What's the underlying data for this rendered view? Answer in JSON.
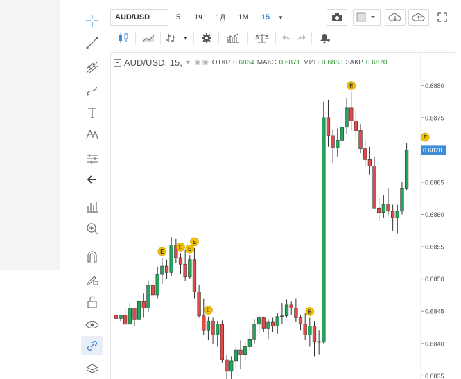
{
  "toolbar": {
    "symbol": "AUD/USD",
    "intervals": [
      "5",
      "1ч",
      "1Д",
      "1М",
      "15"
    ],
    "selected_interval": "15",
    "dropdown_arrow": "▼"
  },
  "legend": {
    "title": "AUD/USD, 15,",
    "open_label": "ОТКР",
    "open_value": "0.6864",
    "high_label": "МАКС",
    "high_value": "0.6871",
    "low_label": "МИН",
    "low_value": "0.6863",
    "close_label": "ЗАКР",
    "close_value": "0.6870"
  },
  "colors": {
    "up": "#26a65b",
    "down": "#e24a4a",
    "accent": "#3d8bd9",
    "event": "#f2c200"
  },
  "chart_data": {
    "type": "candlestick",
    "symbol": "AUD/USD",
    "interval": "15",
    "price_ticks": [
      "0.6880",
      "0.6875",
      "0.6870",
      "0.6865",
      "0.6860",
      "0.6855",
      "0.6850",
      "0.6845",
      "0.6840",
      "0.6835"
    ],
    "last_price": "0.6870",
    "ylim": [
      0.68345,
      0.68825
    ],
    "candles": [
      [
        0.68444,
        0.68444,
        0.68439,
        0.68439
      ],
      [
        0.68439,
        0.68444,
        0.68435,
        0.68444
      ],
      [
        0.68444,
        0.68452,
        0.6843,
        0.6843
      ],
      [
        0.6843,
        0.68462,
        0.6843,
        0.68455
      ],
      [
        0.68455,
        0.68455,
        0.68427,
        0.68437
      ],
      [
        0.68437,
        0.68467,
        0.68437,
        0.68465
      ],
      [
        0.68465,
        0.68478,
        0.6844,
        0.68455
      ],
      [
        0.68455,
        0.68498,
        0.68448,
        0.6849
      ],
      [
        0.6849,
        0.6851,
        0.6847,
        0.68475
      ],
      [
        0.68475,
        0.68518,
        0.6847,
        0.68507
      ],
      [
        0.68507,
        0.68533,
        0.68492,
        0.6852
      ],
      [
        0.6852,
        0.6853,
        0.685,
        0.6851
      ],
      [
        0.6851,
        0.68565,
        0.68505,
        0.68553
      ],
      [
        0.68553,
        0.68562,
        0.68525,
        0.68533
      ],
      [
        0.68533,
        0.6854,
        0.68508,
        0.68523
      ],
      [
        0.68523,
        0.68545,
        0.68497,
        0.68503
      ],
      [
        0.68503,
        0.68537,
        0.685,
        0.6853
      ],
      [
        0.6853,
        0.68548,
        0.6847,
        0.6848
      ],
      [
        0.6848,
        0.6849,
        0.6844,
        0.68443
      ],
      [
        0.68443,
        0.6847,
        0.68413,
        0.6842
      ],
      [
        0.6842,
        0.68442,
        0.68405,
        0.68435
      ],
      [
        0.68435,
        0.6844,
        0.68399,
        0.68413
      ],
      [
        0.68413,
        0.68435,
        0.68395,
        0.6843
      ],
      [
        0.6843,
        0.68436,
        0.6837,
        0.68375
      ],
      [
        0.68375,
        0.68382,
        0.68345,
        0.68357
      ],
      [
        0.68357,
        0.6838,
        0.6834,
        0.68373
      ],
      [
        0.68373,
        0.68395,
        0.6836,
        0.6839
      ],
      [
        0.6839,
        0.68405,
        0.6836,
        0.68383
      ],
      [
        0.68383,
        0.68402,
        0.68374,
        0.68395
      ],
      [
        0.68395,
        0.6842,
        0.68389,
        0.68407
      ],
      [
        0.68407,
        0.68437,
        0.684,
        0.6843
      ],
      [
        0.6843,
        0.68445,
        0.68415,
        0.6844
      ],
      [
        0.6844,
        0.68442,
        0.68418,
        0.68423
      ],
      [
        0.68423,
        0.68437,
        0.68407,
        0.68433
      ],
      [
        0.68433,
        0.6844,
        0.68418,
        0.68427
      ],
      [
        0.68427,
        0.68447,
        0.68415,
        0.68442
      ],
      [
        0.68442,
        0.68462,
        0.6843,
        0.68443
      ],
      [
        0.68443,
        0.68468,
        0.6844,
        0.6846
      ],
      [
        0.6846,
        0.68465,
        0.68445,
        0.68455
      ],
      [
        0.68455,
        0.6847,
        0.68433,
        0.6844
      ],
      [
        0.6844,
        0.68445,
        0.6842,
        0.6843
      ],
      [
        0.6843,
        0.68447,
        0.68405,
        0.68413
      ],
      [
        0.68413,
        0.6844,
        0.68395,
        0.68427
      ],
      [
        0.68427,
        0.68435,
        0.6838,
        0.68403
      ],
      [
        0.68403,
        0.6842,
        0.68383,
        0.68402
      ],
      [
        0.68402,
        0.68775,
        0.684,
        0.6875
      ],
      [
        0.6875,
        0.68778,
        0.68705,
        0.68722
      ],
      [
        0.68722,
        0.68732,
        0.6868,
        0.68703
      ],
      [
        0.68703,
        0.68733,
        0.6869,
        0.68715
      ],
      [
        0.68715,
        0.68755,
        0.68705,
        0.68735
      ],
      [
        0.68735,
        0.6878,
        0.68725,
        0.68765
      ],
      [
        0.68765,
        0.6879,
        0.6873,
        0.68745
      ],
      [
        0.68745,
        0.6876,
        0.68715,
        0.6873
      ],
      [
        0.6873,
        0.6874,
        0.68695,
        0.68702
      ],
      [
        0.68702,
        0.68715,
        0.68675,
        0.68685
      ],
      [
        0.68685,
        0.68705,
        0.68662,
        0.68675
      ],
      [
        0.68675,
        0.6869,
        0.6864,
        0.6861
      ],
      [
        0.6861,
        0.68625,
        0.6859,
        0.68603
      ],
      [
        0.68603,
        0.6863,
        0.68595,
        0.68615
      ],
      [
        0.68615,
        0.6864,
        0.68598,
        0.68605
      ],
      [
        0.68605,
        0.68615,
        0.68575,
        0.68595
      ],
      [
        0.68595,
        0.68615,
        0.6857,
        0.68605
      ],
      [
        0.68605,
        0.6865,
        0.686,
        0.6864
      ],
      [
        0.6864,
        0.6871,
        0.68638,
        0.687
      ]
    ],
    "events": [
      10,
      14,
      16,
      17,
      20,
      42,
      51,
      67
    ]
  }
}
